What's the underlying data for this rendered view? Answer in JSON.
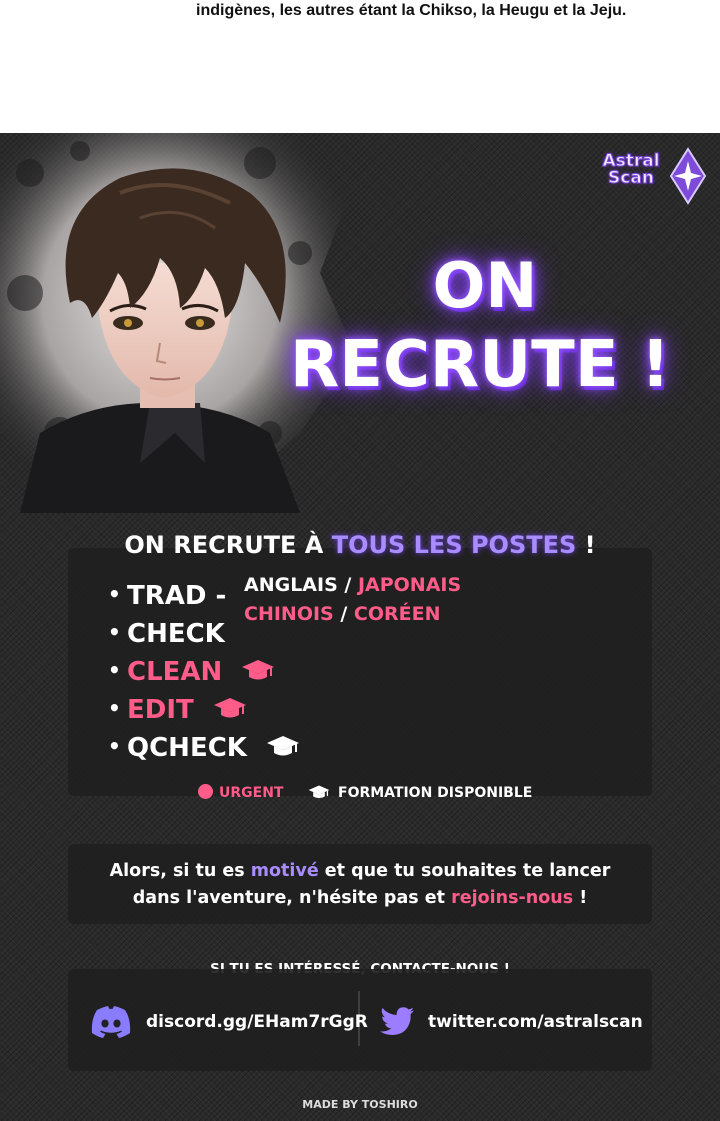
{
  "top_caption": "indigènes, les autres étant la Chikso, la Heugu et la Jeju.",
  "logo": {
    "line1": "Astral",
    "line2": "Scan",
    "icon": "diamond-star-icon"
  },
  "headline": {
    "line1": "ON",
    "line2": "RECRUTE !"
  },
  "roles_section": {
    "title_prefix": "ON RECRUTE À ",
    "title_accent": "TOUS LES POSTES",
    "title_suffix": " !",
    "roles": [
      {
        "label": "TRAD -",
        "urgent": false,
        "training": false
      },
      {
        "label": "CHECK",
        "urgent": false,
        "training": false
      },
      {
        "label": "CLEAN",
        "urgent": true,
        "training": true
      },
      {
        "label": "EDIT",
        "urgent": true,
        "training": true
      },
      {
        "label": "QCHECK",
        "urgent": false,
        "training": true
      }
    ],
    "languages": {
      "line1_a": "ANGLAIS",
      "line1_sep": " / ",
      "line1_b": "JAPONAIS",
      "line2_a": "CHINOIS",
      "line2_sep": " / ",
      "line2_b": "CORÉEN"
    },
    "legend": {
      "urgent": "URGENT",
      "training": "FORMATION DISPONIBLE"
    }
  },
  "motive": {
    "part1": "Alors, si tu es ",
    "accent": "motivé",
    "part2": " et que tu souhaites te lancer",
    "part3": "dans l'aventure, n'hésite pas et ",
    "pink": "rejoins-nous",
    "part4": " !"
  },
  "contact": {
    "title": "SI TU ES INTÉRESSÉ, CONTACTE-NOUS !",
    "discord": "discord.gg/EHam7rGgR",
    "twitter": "twitter.com/astralscan"
  },
  "credit": "MADE BY TOSHIRO",
  "colors": {
    "accent_purple": "#a98cff",
    "accent_pink": "#ff5c8a",
    "background": "#2a2a2a",
    "discord": "#8a7cff",
    "twitter": "#9d7dff"
  }
}
